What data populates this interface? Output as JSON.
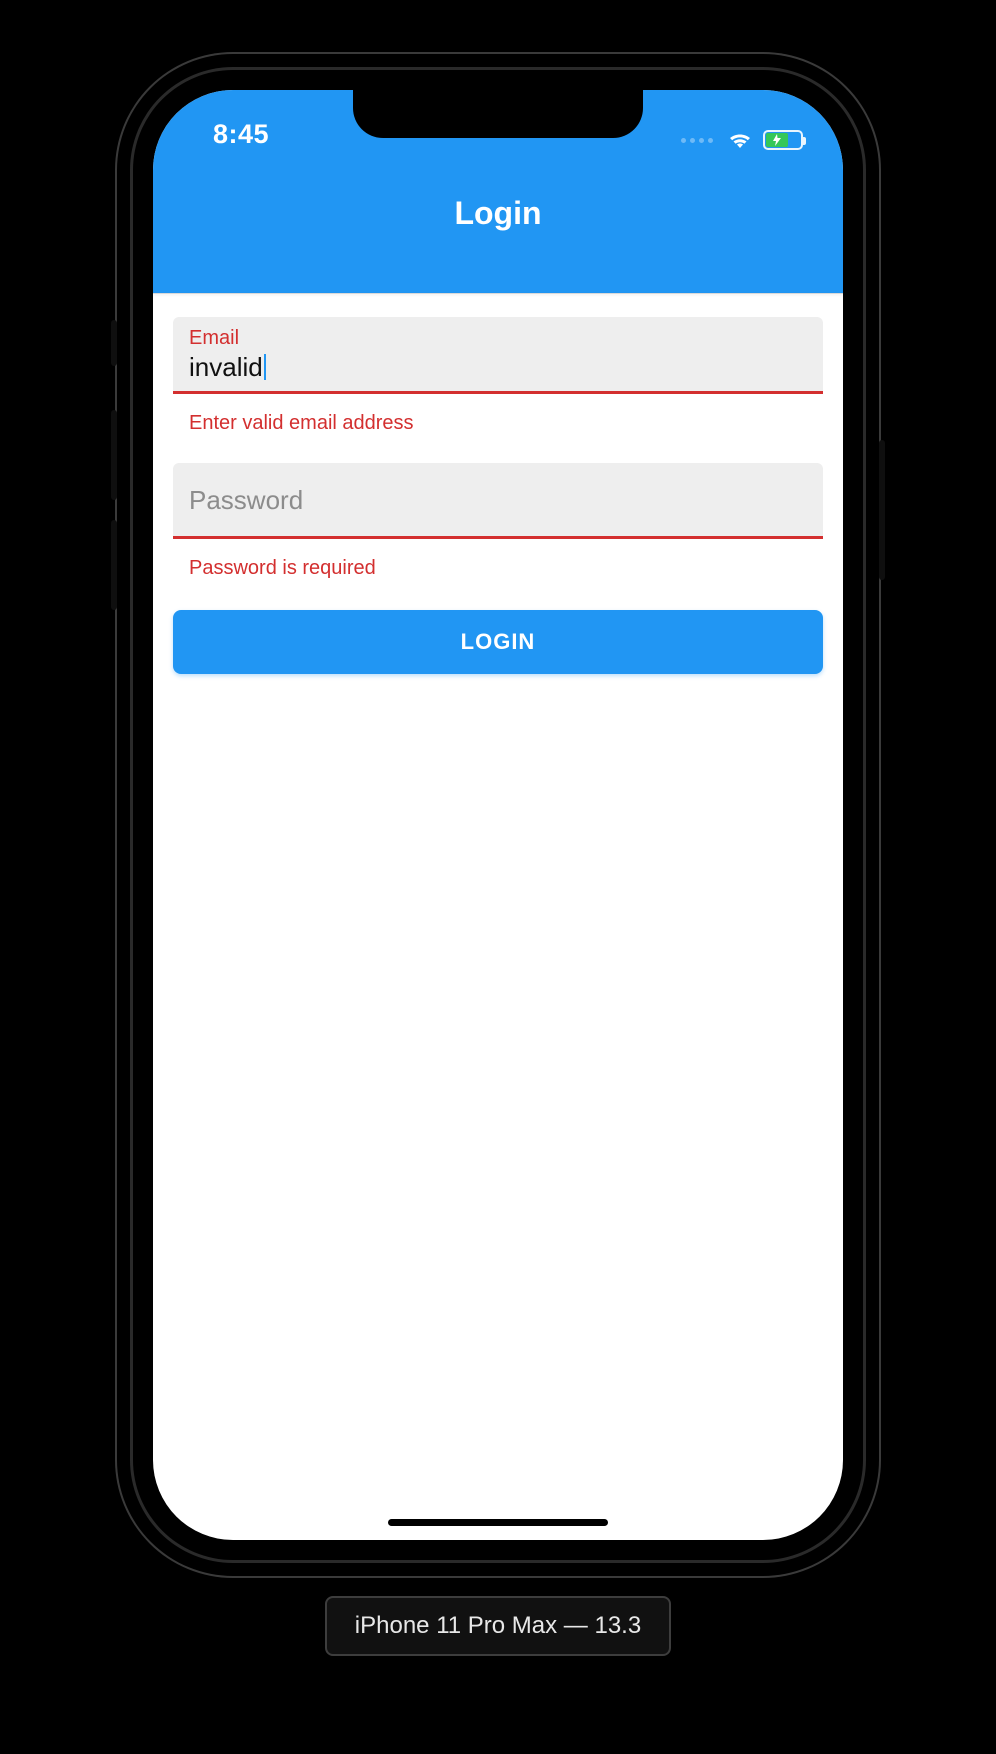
{
  "status": {
    "time": "8:45"
  },
  "header": {
    "title": "Login"
  },
  "form": {
    "email": {
      "label": "Email",
      "value": "invalid",
      "error": "Enter valid email address"
    },
    "password": {
      "placeholder": "Password",
      "value": "",
      "error": "Password is required"
    },
    "submit_label": "LOGIN"
  },
  "simulator": {
    "caption": "iPhone 11 Pro Max — 13.3"
  },
  "colors": {
    "primary": "#2196f3",
    "error": "#d32f2f",
    "battery_fill": "#34c759"
  }
}
